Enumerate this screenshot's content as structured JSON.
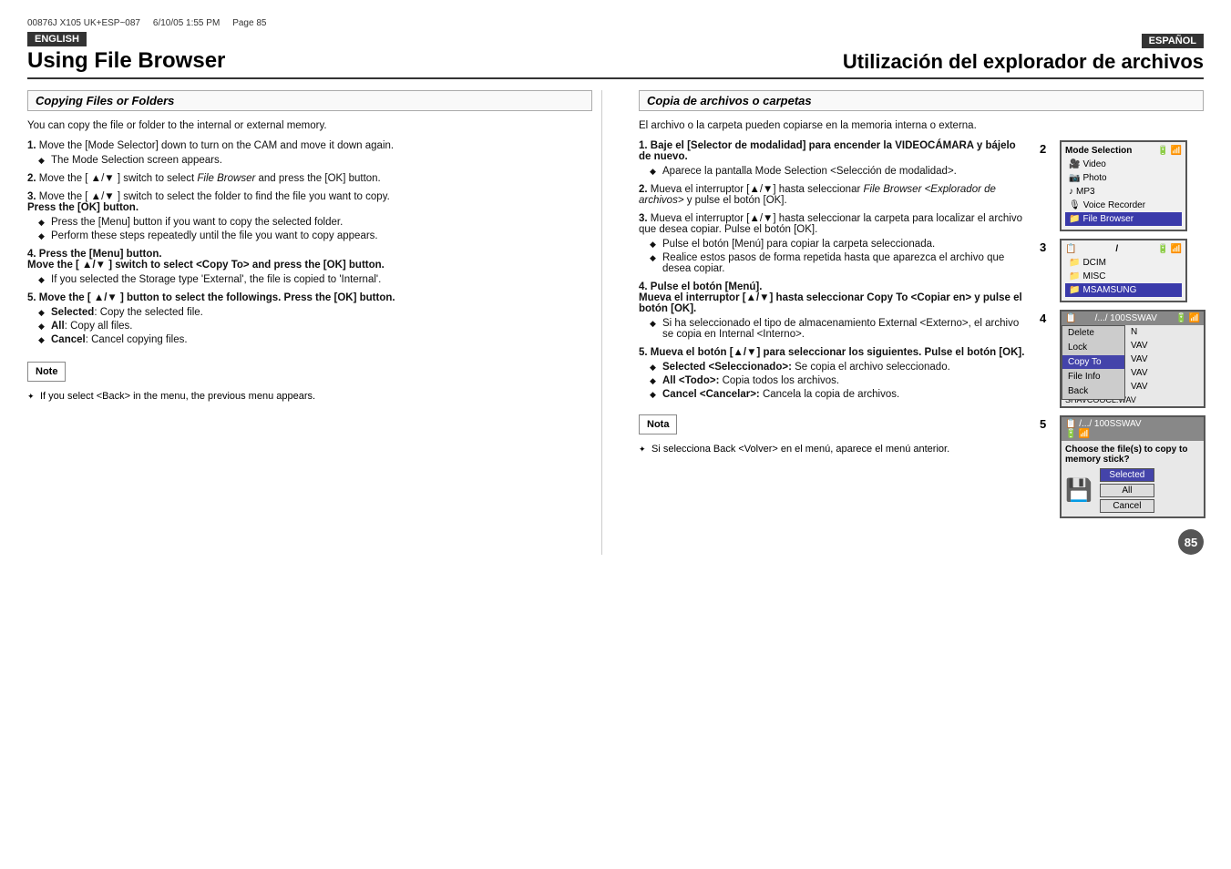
{
  "meta": {
    "doc_code": "00876J X105 UK+ESP~087",
    "date": "6/10/05 1:55 PM",
    "page": "Page  85"
  },
  "left_column": {
    "lang_badge": "ENGLISH",
    "title": "Using File Browser",
    "section_heading": "Copying Files or Folders",
    "intro": "You can copy the file or folder to the internal or external memory.",
    "steps": [
      {
        "num": "1.",
        "main": "Move the [Mode Selector] down to turn on the CAM and move it down again.",
        "subs": [
          "The Mode Selection screen appears."
        ]
      },
      {
        "num": "2.",
        "main": "Move the [ ▲/▼ ] switch to select File Browser and press the [OK] button.",
        "subs": []
      },
      {
        "num": "3.",
        "main": "Move the [ ▲/▼ ] switch to select the folder to find the file you want to copy. Press the [OK] button.",
        "subs": [
          "Press the [Menu] button if you want to copy the selected folder.",
          "Perform these steps repeatedly until the file you want to copy appears."
        ]
      },
      {
        "num": "4.",
        "main": "Press the [Menu] button. Move the [ ▲/▼ ] switch to select <Copy To> and press the [OK] button.",
        "subs": [
          "If you selected the Storage type 'External', the file is copied to 'Internal'."
        ]
      },
      {
        "num": "5.",
        "main": "Move the [ ▲/▼ ] button to select the followings. Press the [OK] button.",
        "subs": [
          "Selected: Copy the selected file.",
          "All: Copy all files.",
          "Cancel: Cancel copying files."
        ]
      }
    ],
    "note_label": "Note",
    "note_text": "If you select <Back> in the menu, the previous menu appears."
  },
  "right_column": {
    "lang_badge": "ESPAÑOL",
    "title": "Utilización del explorador de archivos",
    "section_heading": "Copia de archivos o carpetas",
    "intro": "El archivo o la carpeta pueden copiarse en la memoria interna o externa.",
    "steps": [
      {
        "num": "1.",
        "main": "Baje el [Selector de modalidad] para encender la VIDEOCÁMARA y bájelo de nuevo.",
        "subs": [
          "Aparece la pantalla Mode Selection <Selección de modalidad>."
        ]
      },
      {
        "num": "2.",
        "main": "Mueva el interruptor [▲/▼] hasta seleccionar File Browser <Explorador de archivos> y pulse el botón [OK].",
        "subs": []
      },
      {
        "num": "3.",
        "main": "Mueva el interruptor [▲/▼] hasta seleccionar la carpeta para localizar el archivo que desea copiar. Pulse el botón [OK].",
        "subs": [
          "Pulse el botón [Menú] para copiar la carpeta seleccionada.",
          "Realice estos pasos de forma repetida hasta que aparezca el archivo que desea copiar."
        ]
      },
      {
        "num": "4.",
        "main": "Pulse el botón [Menú]. Mueva el interruptor [▲/▼] hasta seleccionar Copy To <Copiar en> y pulse el botón [OK].",
        "subs": [
          "Si ha seleccionado el tipo de almacenamiento External <Externo>, el archivo se copia en Internal <Interno>."
        ]
      },
      {
        "num": "5.",
        "main": "Mueva el botón [▲/▼] para seleccionar los siguientes. Pulse el botón [OK].",
        "subs": [
          "Selected <Seleccionado>: Se copia el archivo seleccionado.",
          "All <Todo>: Copia todos los archivos.",
          "Cancel <Cancelar>: Cancela la copia de archivos."
        ]
      }
    ],
    "note_label": "Nota",
    "note_text": "Si selecciona Back <Volver> en el menú, aparece el menú anterior."
  },
  "screens": {
    "screen2": {
      "title": "Mode Selection",
      "items": [
        "Video",
        "Photo",
        "MP3",
        "Voice Recorder",
        "File Browser"
      ],
      "selected": "File Browser"
    },
    "screen3": {
      "title": "/",
      "items": [
        "DCIM",
        "MISC",
        "MSAMSUNG"
      ],
      "selected": "MSAMSUNG"
    },
    "screen4": {
      "title": "/.../ 100SSWAV",
      "menu_items": [
        "Delete",
        "Lock",
        "Copy To",
        "File Info",
        "Back"
      ],
      "file_items": [
        "VAV",
        "VAV",
        "VAV",
        "VAV",
        "SHAVCOOCL.WAV"
      ]
    },
    "screen5": {
      "title": "/.../ 100SSWAV",
      "dialog_title": "Choose the file(s) to copy to memory stick?",
      "options": [
        "Selected",
        "All",
        "Cancel"
      ]
    }
  },
  "page_number": "85"
}
